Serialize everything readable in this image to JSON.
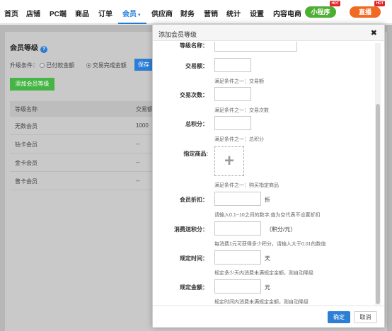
{
  "nav": {
    "items": [
      "首页",
      "店铺",
      "PC端",
      "商品",
      "订单",
      "会员",
      "供应商",
      "财务",
      "营销",
      "统计",
      "设置",
      "内容电商"
    ],
    "active_index": 5,
    "mini_program": "小程序",
    "live": "直播",
    "hot_badge": "HOT"
  },
  "page": {
    "title": "会员等级",
    "upgrade_label": "升级条件：",
    "radio_paid": "已付款金额",
    "radio_completed": "交易完成金额",
    "save": "保存",
    "add_level": "添加会员等级",
    "table": {
      "headers": [
        "等级名称",
        "交易额"
      ],
      "rows": [
        [
          "无数会员",
          "1000"
        ],
        [
          "钻卡会员",
          "--"
        ],
        [
          "金卡会员",
          "--"
        ],
        [
          "普卡会员",
          "--"
        ]
      ]
    }
  },
  "modal": {
    "title": "添加会员等级",
    "close": "✖",
    "level_name_label": "等级名称：",
    "trade_amount_label": "交易额：",
    "trade_amount_hint": "满足条件之一：交易额",
    "trade_count_label": "交易次数：",
    "trade_count_hint": "满足条件之一：交易次数",
    "points_label": "总积分：",
    "points_hint": "满足条件之一：总积分",
    "goods_label": "指定商品:",
    "goods_hint": "满足条件之一：购买指定商品",
    "discount_label": "会员折扣：",
    "discount_unit": "折",
    "discount_hint": "请输入0.1~10之间的数字,值为空代表不设置折扣",
    "consume_points_label": "消费送积分：",
    "consume_points_unit": "（积分/元）",
    "consume_points_hint": "每消费1元可获得多少积分，请输入大于0.01的数值",
    "period_label": "规定时间：",
    "period_unit": "天",
    "period_hint": "规定多少天内消费未满规定金额，则自动降级",
    "amount_label": "规定金额：",
    "amount_unit": "元",
    "amount_hint": "规定时间内消费未满规定金额，则自动降级",
    "confirm": "确定",
    "cancel": "取消"
  }
}
